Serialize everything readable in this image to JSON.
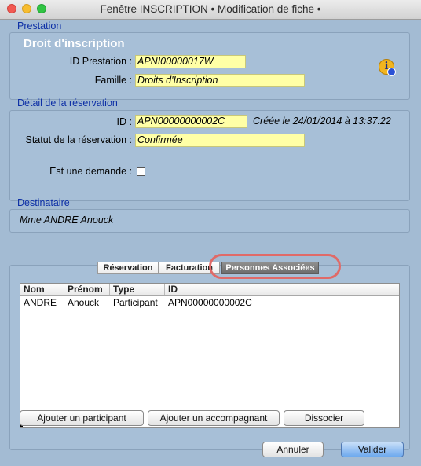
{
  "window": {
    "title": "Fenêtre INSCRIPTION • Modification de fiche •"
  },
  "prestation": {
    "section_title": "Prestation",
    "heading": "Droit d'inscription",
    "id_label": "ID Prestation :",
    "id_value": "APNI00000017W",
    "famille_label": "Famille :",
    "famille_value": "Droits d'Inscription",
    "info_icon": "info-icon"
  },
  "reservation": {
    "section_title": "Détail de la réservation",
    "id_label": "ID :",
    "id_value": "APN00000000002C",
    "created_text": "Créée le 24/01/2014 à 13:37:22",
    "statut_label": "Statut de la réservation :",
    "statut_value": "Confirmée",
    "demande_label": "Est une demande :",
    "demande_checked": false
  },
  "destinataire": {
    "section_title": "Destinataire",
    "name": "Mme ANDRE Anouck"
  },
  "tabs": [
    {
      "label": "Réservation",
      "active": false
    },
    {
      "label": "Facturation",
      "active": false
    },
    {
      "label": "Personnes Associées",
      "active": true
    }
  ],
  "table": {
    "columns": [
      "Nom",
      "Prénom",
      "Type",
      "ID"
    ],
    "rows": [
      [
        "ANDRE",
        "Anouck",
        "Participant",
        "APN00000000002C"
      ]
    ]
  },
  "actions": {
    "add_participant": "Ajouter un participant",
    "add_companion": "Ajouter un accompagnant",
    "dissociate": "Dissocier"
  },
  "footer": {
    "cancel": "Annuler",
    "validate": "Valider"
  },
  "colors": {
    "background": "#a3bbd3",
    "section_title": "#0d2fa6",
    "field_yellow": "#ffffa6",
    "highlight_ring": "#e06a68",
    "default_button": "#6ea9ee"
  }
}
